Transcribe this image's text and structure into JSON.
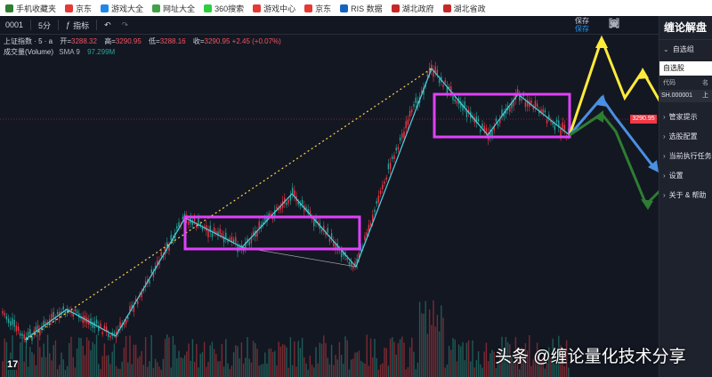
{
  "bookmarks": [
    {
      "label": "手机收藏夹",
      "color": "#2e7d32"
    },
    {
      "label": "京东",
      "color": "#e53935"
    },
    {
      "label": "游戏大全",
      "color": "#1e88e5"
    },
    {
      "label": "网址大全",
      "color": "#43a047"
    },
    {
      "label": "360搜索",
      "color": "#2ecc40"
    },
    {
      "label": "游戏中心",
      "color": "#e53935"
    },
    {
      "label": "京东",
      "color": "#e53935"
    },
    {
      "label": "RIS 数据",
      "color": "#1565c0"
    },
    {
      "label": "湖北政府",
      "color": "#c62828"
    },
    {
      "label": "湖北省政",
      "color": "#c62828"
    }
  ],
  "toolbar": {
    "symbol_code": "0001",
    "interval": "5分",
    "indicators_label": "指标",
    "save_label": "保存",
    "save_sub": "保存"
  },
  "legend": {
    "symbol_title": "上证指数 · 5 · a",
    "open_label": "开=",
    "open": "3288.32",
    "high_label": "高=",
    "high": "3290.95",
    "low_label": "低=",
    "low": "3288.16",
    "close_label": "收=",
    "close": "3290.95",
    "change": "+2.45 (+0.07%)",
    "volume_label": "成交量(Volume)",
    "sma_label": "SMA 9",
    "volume_value": "97.299M"
  },
  "price_tag": "3290.95",
  "panel": {
    "title": "缠论解盘",
    "watchlist_group": "自选组",
    "watchlist_name": "自选股",
    "col_code": "代码",
    "col_name": "名",
    "row_code": "SH.000001",
    "row_name": "上",
    "items": [
      "管家提示",
      "选股配置",
      "当前执行任务",
      "设置",
      "关于 & 帮助"
    ]
  },
  "watermark": "头条 @缠论量化技术分享",
  "colors": {
    "background": "#131722",
    "up": "#f23645",
    "down": "#26a69a",
    "box": "#e040fb",
    "trend": "#4dd0e1"
  }
}
